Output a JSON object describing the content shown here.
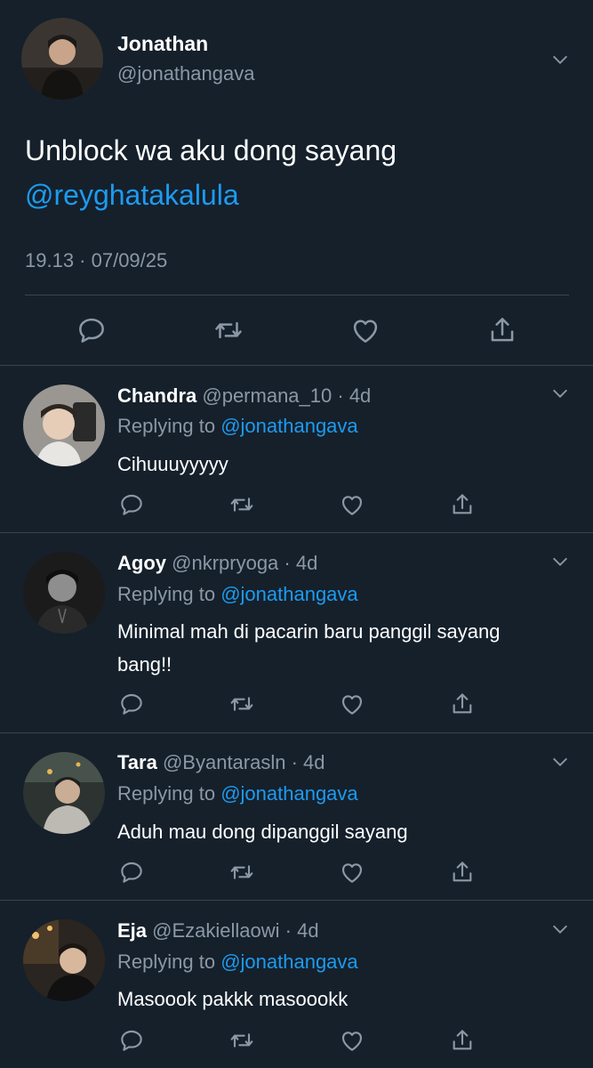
{
  "theme": {
    "background": "#15202b",
    "accent": "#1d9bf0",
    "muted": "#8b98a5",
    "divider": "#38444d"
  },
  "main": {
    "name": "Jonathan",
    "handle": "@jonathangava",
    "text": "Unblock wa aku dong sayang",
    "mention": "@reyghatakalula",
    "timestamp": "19.13 · 07/09/25",
    "icons": [
      "reply-icon",
      "retweet-icon",
      "like-icon",
      "share-icon"
    ]
  },
  "replies": [
    {
      "name": "Chandra",
      "handle": "@permana_10",
      "age": "· 4d",
      "replying_label": "Replying to",
      "replying_to": "@jonathangava",
      "text": "Cihuuuyyyyy"
    },
    {
      "name": "Agoy",
      "handle": "@nkrpryoga",
      "age": "· 4d",
      "replying_label": "Replying to",
      "replying_to": "@jonathangava",
      "text": "Minimal mah di pacarin baru panggil sayang bang!!"
    },
    {
      "name": "Tara",
      "handle": "@Byantarasln",
      "age": "· 4d",
      "replying_label": "Replying to",
      "replying_to": "@jonathangava",
      "text": "Aduh mau dong dipanggil sayang"
    },
    {
      "name": "Eja",
      "handle": "@Ezakiellaowi",
      "age": "· 4d",
      "replying_label": "Replying to",
      "replying_to": "@jonathangava",
      "text": "Masoook pakkk masoookk"
    }
  ]
}
